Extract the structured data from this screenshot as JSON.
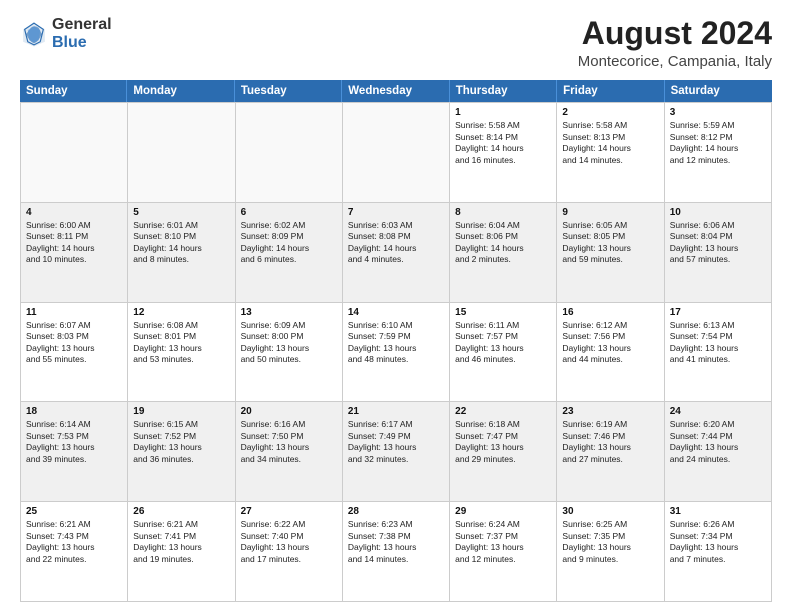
{
  "logo": {
    "general": "General",
    "blue": "Blue"
  },
  "title": {
    "month_year": "August 2024",
    "location": "Montecorice, Campania, Italy"
  },
  "weekdays": [
    "Sunday",
    "Monday",
    "Tuesday",
    "Wednesday",
    "Thursday",
    "Friday",
    "Saturday"
  ],
  "weeks": [
    [
      {
        "day": "",
        "info": ""
      },
      {
        "day": "",
        "info": ""
      },
      {
        "day": "",
        "info": ""
      },
      {
        "day": "",
        "info": ""
      },
      {
        "day": "1",
        "info": "Sunrise: 5:58 AM\nSunset: 8:14 PM\nDaylight: 14 hours\nand 16 minutes."
      },
      {
        "day": "2",
        "info": "Sunrise: 5:58 AM\nSunset: 8:13 PM\nDaylight: 14 hours\nand 14 minutes."
      },
      {
        "day": "3",
        "info": "Sunrise: 5:59 AM\nSunset: 8:12 PM\nDaylight: 14 hours\nand 12 minutes."
      }
    ],
    [
      {
        "day": "4",
        "info": "Sunrise: 6:00 AM\nSunset: 8:11 PM\nDaylight: 14 hours\nand 10 minutes."
      },
      {
        "day": "5",
        "info": "Sunrise: 6:01 AM\nSunset: 8:10 PM\nDaylight: 14 hours\nand 8 minutes."
      },
      {
        "day": "6",
        "info": "Sunrise: 6:02 AM\nSunset: 8:09 PM\nDaylight: 14 hours\nand 6 minutes."
      },
      {
        "day": "7",
        "info": "Sunrise: 6:03 AM\nSunset: 8:08 PM\nDaylight: 14 hours\nand 4 minutes."
      },
      {
        "day": "8",
        "info": "Sunrise: 6:04 AM\nSunset: 8:06 PM\nDaylight: 14 hours\nand 2 minutes."
      },
      {
        "day": "9",
        "info": "Sunrise: 6:05 AM\nSunset: 8:05 PM\nDaylight: 13 hours\nand 59 minutes."
      },
      {
        "day": "10",
        "info": "Sunrise: 6:06 AM\nSunset: 8:04 PM\nDaylight: 13 hours\nand 57 minutes."
      }
    ],
    [
      {
        "day": "11",
        "info": "Sunrise: 6:07 AM\nSunset: 8:03 PM\nDaylight: 13 hours\nand 55 minutes."
      },
      {
        "day": "12",
        "info": "Sunrise: 6:08 AM\nSunset: 8:01 PM\nDaylight: 13 hours\nand 53 minutes."
      },
      {
        "day": "13",
        "info": "Sunrise: 6:09 AM\nSunset: 8:00 PM\nDaylight: 13 hours\nand 50 minutes."
      },
      {
        "day": "14",
        "info": "Sunrise: 6:10 AM\nSunset: 7:59 PM\nDaylight: 13 hours\nand 48 minutes."
      },
      {
        "day": "15",
        "info": "Sunrise: 6:11 AM\nSunset: 7:57 PM\nDaylight: 13 hours\nand 46 minutes."
      },
      {
        "day": "16",
        "info": "Sunrise: 6:12 AM\nSunset: 7:56 PM\nDaylight: 13 hours\nand 44 minutes."
      },
      {
        "day": "17",
        "info": "Sunrise: 6:13 AM\nSunset: 7:54 PM\nDaylight: 13 hours\nand 41 minutes."
      }
    ],
    [
      {
        "day": "18",
        "info": "Sunrise: 6:14 AM\nSunset: 7:53 PM\nDaylight: 13 hours\nand 39 minutes."
      },
      {
        "day": "19",
        "info": "Sunrise: 6:15 AM\nSunset: 7:52 PM\nDaylight: 13 hours\nand 36 minutes."
      },
      {
        "day": "20",
        "info": "Sunrise: 6:16 AM\nSunset: 7:50 PM\nDaylight: 13 hours\nand 34 minutes."
      },
      {
        "day": "21",
        "info": "Sunrise: 6:17 AM\nSunset: 7:49 PM\nDaylight: 13 hours\nand 32 minutes."
      },
      {
        "day": "22",
        "info": "Sunrise: 6:18 AM\nSunset: 7:47 PM\nDaylight: 13 hours\nand 29 minutes."
      },
      {
        "day": "23",
        "info": "Sunrise: 6:19 AM\nSunset: 7:46 PM\nDaylight: 13 hours\nand 27 minutes."
      },
      {
        "day": "24",
        "info": "Sunrise: 6:20 AM\nSunset: 7:44 PM\nDaylight: 13 hours\nand 24 minutes."
      }
    ],
    [
      {
        "day": "25",
        "info": "Sunrise: 6:21 AM\nSunset: 7:43 PM\nDaylight: 13 hours\nand 22 minutes."
      },
      {
        "day": "26",
        "info": "Sunrise: 6:21 AM\nSunset: 7:41 PM\nDaylight: 13 hours\nand 19 minutes."
      },
      {
        "day": "27",
        "info": "Sunrise: 6:22 AM\nSunset: 7:40 PM\nDaylight: 13 hours\nand 17 minutes."
      },
      {
        "day": "28",
        "info": "Sunrise: 6:23 AM\nSunset: 7:38 PM\nDaylight: 13 hours\nand 14 minutes."
      },
      {
        "day": "29",
        "info": "Sunrise: 6:24 AM\nSunset: 7:37 PM\nDaylight: 13 hours\nand 12 minutes."
      },
      {
        "day": "30",
        "info": "Sunrise: 6:25 AM\nSunset: 7:35 PM\nDaylight: 13 hours\nand 9 minutes."
      },
      {
        "day": "31",
        "info": "Sunrise: 6:26 AM\nSunset: 7:34 PM\nDaylight: 13 hours\nand 7 minutes."
      }
    ]
  ]
}
